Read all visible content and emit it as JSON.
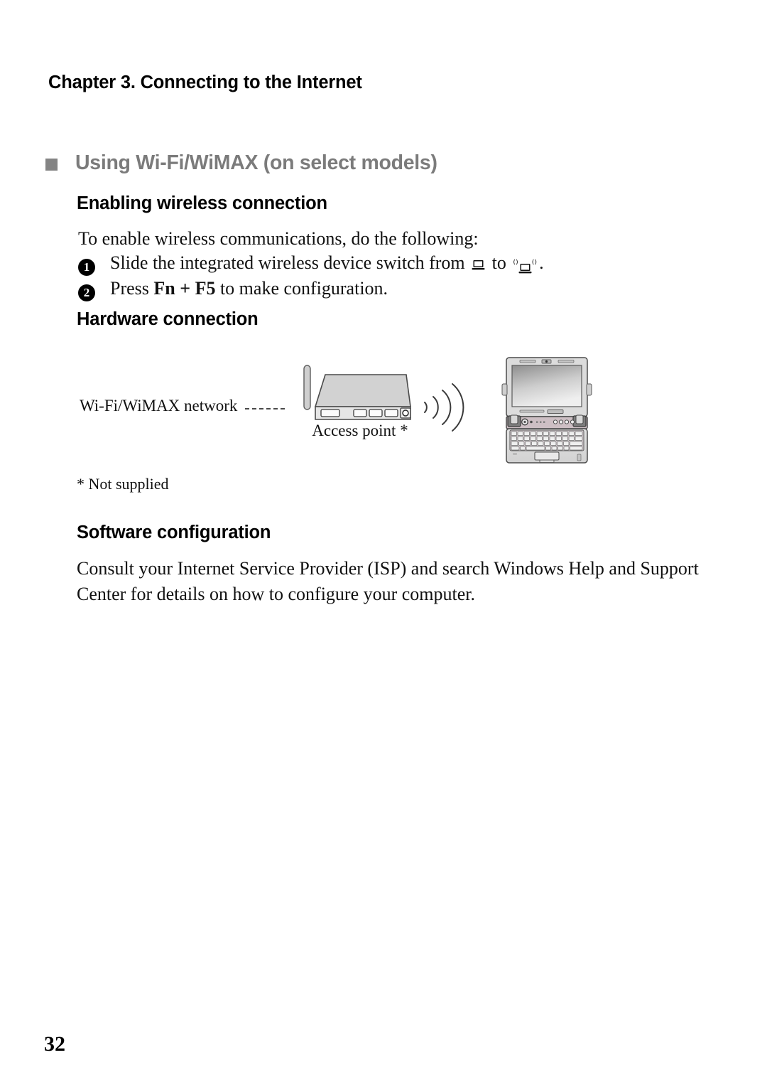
{
  "document": {
    "chapter_header": "Chapter 3. Connecting to the Internet",
    "page_number": "32"
  },
  "section": {
    "bullet_icon": "square-bullet-icon",
    "title": "Using Wi-Fi/WiMAX (on select models)",
    "title_color": "#7b7b7b",
    "bullet_color": "#848484"
  },
  "enabling": {
    "heading": "Enabling wireless connection",
    "intro": "To enable wireless communications, do the following:",
    "steps": [
      {
        "number": "1",
        "text_before": "Slide the integrated wireless device switch from",
        "icon_off": "laptop-off-icon",
        "text_middle": "to",
        "icon_on": "laptop-wireless-on-icon",
        "text_after": "."
      },
      {
        "number": "2",
        "text_before": "Press",
        "key_combo": "Fn + F5",
        "text_after": "to make configuration."
      }
    ]
  },
  "hardware": {
    "heading": "Hardware connection",
    "network_label": "Wi-Fi/WiMAX network",
    "connector": "dashed-line",
    "access_point_label": "Access point *",
    "access_point_icon": "wireless-router-icon",
    "signal_icon": "wireless-signal-waves-icon",
    "computer_icon": "laptop-computer-icon",
    "footnote": "* Not supplied"
  },
  "software": {
    "heading": "Software configuration",
    "paragraph": "Consult your Internet Service Provider (ISP) and search Windows Help and Support Center for details on how to configure your computer."
  }
}
